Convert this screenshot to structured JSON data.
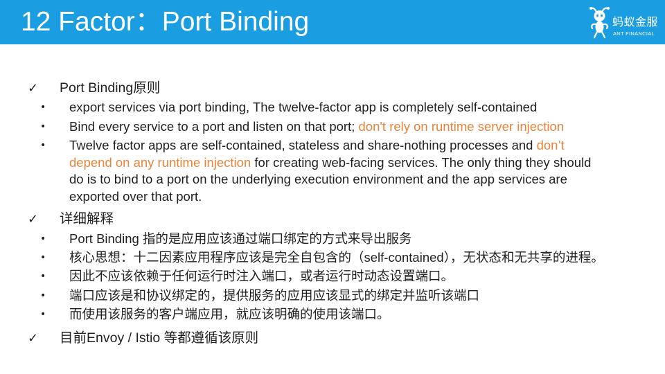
{
  "header": {
    "title": "12 Factor：Port Binding",
    "logo": {
      "icon": "ant-logo-icon",
      "name_cn": "蚂蚁金服",
      "name_en": "ANT FINANCIAL"
    }
  },
  "icons": {
    "check": "✓",
    "bullet": "•"
  },
  "colors": {
    "header_background": "#1b9de2",
    "highlight": "#e8833a",
    "body_text": "#1f1f1f"
  },
  "sections": [
    {
      "heading": "Port Binding原则",
      "bullets": [
        {
          "text": "export services via port binding, The twelve-factor app is completely self-contained"
        },
        {
          "text": "Bind every service to a port and listen on that port; ",
          "highlight": "don't rely on runtime server injection"
        },
        {
          "text": "Twelve factor apps are self-contained, stateless and share-nothing processes and ",
          "highlight": "don’t depend on any runtime injection",
          "text_after": " for creating web-facing services. The only thing they should do is to bind to a port on the underlying execution environment and the app services are exported over that port."
        }
      ]
    },
    {
      "heading": "详细解释",
      "bullets": [
        {
          "text": "Port Binding 指的是应用应该通过端口绑定的方式来导出服务"
        },
        {
          "text": "核心思想：十二因素应用程序应该是完全自包含的（self-contained），无状态和无共享的进程。"
        },
        {
          "text": "因此不应该依赖于任何运行时注入端口，或者运行时动态设置端口。"
        },
        {
          "text": "端口应该是和协议绑定的，提供服务的应用应该显式的绑定并监听该端口"
        },
        {
          "text": "而使用该服务的客户端应用，就应该明确的使用该端口。"
        }
      ]
    },
    {
      "heading": "目前Envoy / Istio 等都遵循该原则",
      "bullets": []
    }
  ]
}
